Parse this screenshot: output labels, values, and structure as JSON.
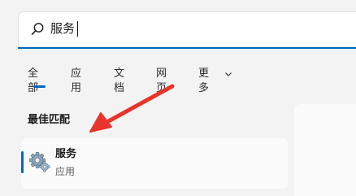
{
  "search": {
    "value": "服务",
    "icon": "search-icon"
  },
  "tabs": [
    {
      "label": "全部",
      "selected": true
    },
    {
      "label": "应用"
    },
    {
      "label": "文档"
    },
    {
      "label": "网页"
    },
    {
      "label": "更多"
    }
  ],
  "best_match": {
    "heading": "最佳匹配",
    "item": {
      "title": "服务",
      "subtitle": "应用",
      "icon": "services-gear-icon"
    }
  },
  "annotation": {
    "arrow_color": "#e8342a"
  },
  "colors": {
    "accent": "#0067c0",
    "background": "#f3f3f3",
    "card": "#fbfbfb"
  }
}
